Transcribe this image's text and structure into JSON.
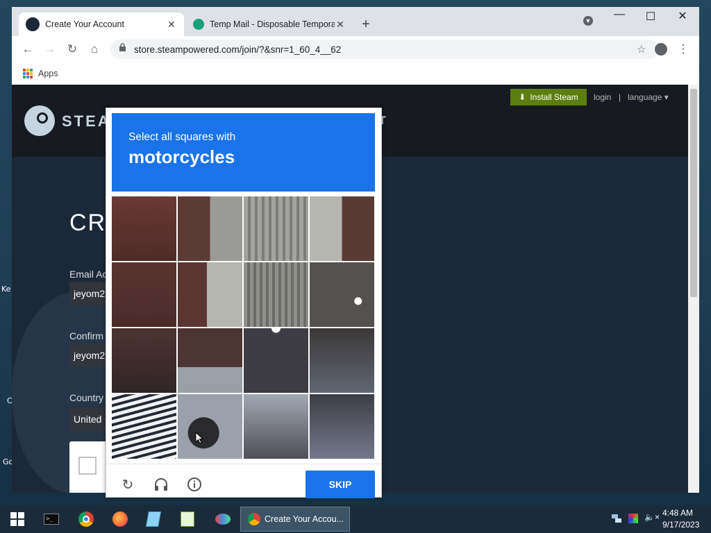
{
  "desktop": {
    "labels": [
      "Ke",
      "C",
      "Go"
    ]
  },
  "browser": {
    "tabs": [
      {
        "title": "Create Your Account",
        "active": true
      },
      {
        "title": "Temp Mail - Disposable Tempora",
        "active": false
      }
    ],
    "url": "store.steampowered.com/join/?&snr=1_60_4__62",
    "bookmarks": {
      "apps_label": "Apps"
    }
  },
  "steam": {
    "install_label": "Install Steam",
    "login_label": "login",
    "separator": "|",
    "language_label": "language",
    "logo_text": "STEA",
    "logo_tail": "RT",
    "create_title": "CRI",
    "email_label": "Email Ac",
    "email_value": "jeyom2",
    "confirm_label": "Confirm",
    "confirm_value": "jeyom2",
    "country_label": "Country",
    "country_value": "United"
  },
  "captcha": {
    "instruction": "Select all squares with",
    "target": "motorcycles",
    "skip_label": "SKIP",
    "header_color": "#1a73e8"
  },
  "taskbar": {
    "active_window": "Create Your Accou...",
    "time": "4:48 AM",
    "date": "9/17/2023"
  }
}
